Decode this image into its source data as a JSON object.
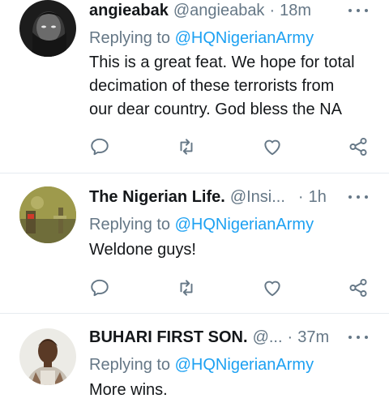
{
  "tweets": [
    {
      "display_name": "angieabak",
      "handle": "@angieabak",
      "separator": "·",
      "time": "18m",
      "replying_label": "Replying to",
      "replying_to": "@HQNigerianArmy",
      "text_lines": [
        "This is a great feat. We hope for total",
        "decimation of these terrorists from",
        "our dear country. God bless the NA"
      ]
    },
    {
      "display_name": "The Nigerian Life.",
      "handle": "@Insi...",
      "separator": "·",
      "time": "1h",
      "replying_label": "Replying to",
      "replying_to": "@HQNigerianArmy",
      "text_lines": [
        "Weldone guys!"
      ]
    },
    {
      "display_name": "BUHARI FIRST SON.",
      "handle": "@...",
      "separator": "·",
      "time": "37m",
      "replying_label": "Replying to",
      "replying_to": "@HQNigerianArmy",
      "text_lines": [
        "More wins."
      ]
    }
  ],
  "icons": {
    "reply": "reply-icon",
    "retweet": "retweet-icon",
    "like": "like-icon",
    "share": "share-icon",
    "more": "more-icon"
  },
  "colors": {
    "link": "#1da1f2",
    "secondary_text": "#657786",
    "icon": "#657786",
    "divider": "#e6ecf0"
  }
}
